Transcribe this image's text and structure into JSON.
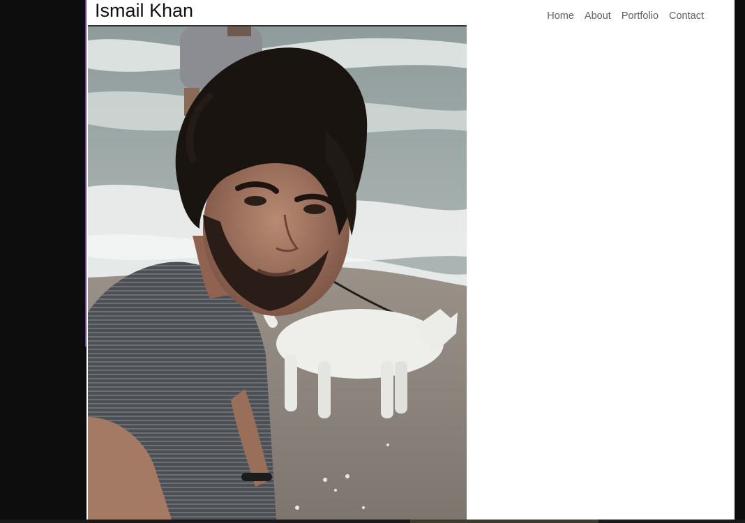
{
  "site": {
    "title": "Ismail Khan"
  },
  "nav": {
    "items": [
      {
        "label": "Home"
      },
      {
        "label": "About"
      },
      {
        "label": "Portfolio"
      },
      {
        "label": "Contact"
      }
    ]
  },
  "hero_photo": {
    "subject": "selfie on beach with white dog"
  },
  "colors": {
    "outer_background": "#0d0d0d",
    "page_background": "#ffffff",
    "nav_text": "#5f5f5f",
    "title_text": "#111111",
    "accent_edge": "#6b3fa0"
  }
}
